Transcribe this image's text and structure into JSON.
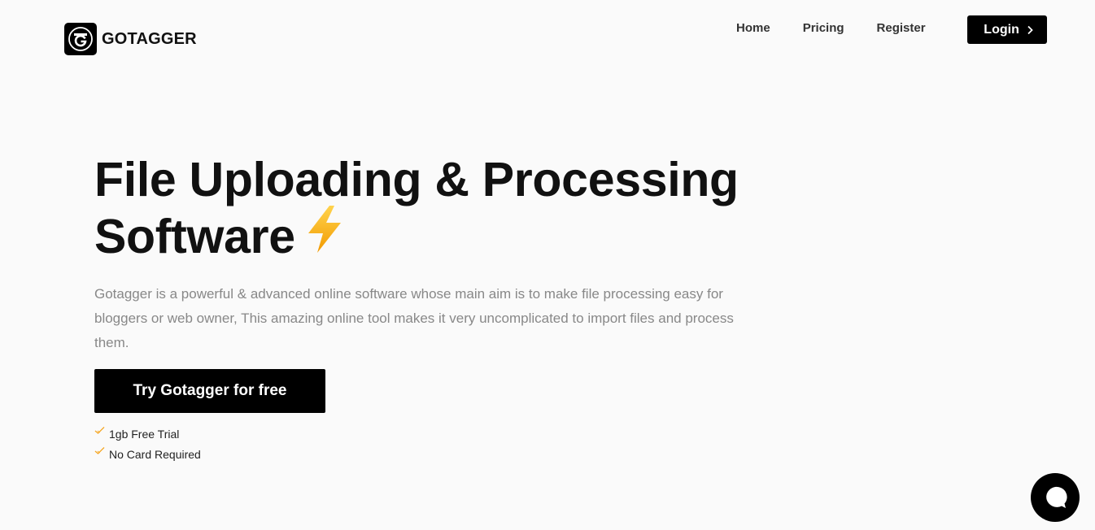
{
  "brand": {
    "name": "GOTAGGER",
    "logo_icon": "gotagger-logo-icon"
  },
  "nav": {
    "items": [
      {
        "label": "Home"
      },
      {
        "label": "Pricing"
      },
      {
        "label": "Register"
      }
    ],
    "login_label": "Login",
    "login_icon": "chevron-right-icon"
  },
  "hero": {
    "title_line1": "File Uploading & Processing",
    "title_line2": "Software",
    "title_icon": "lightning-bolt-icon",
    "description": "Gotagger is a powerful & advanced online software whose main aim is to make file processing easy for bloggers or web owner, This amazing online tool makes it very uncomplicated to import files and process them.",
    "cta_label": "Try Gotagger for free",
    "features": [
      {
        "label": "1gb Free Trial",
        "icon": "check-icon"
      },
      {
        "label": "No Card Required",
        "icon": "check-icon"
      }
    ]
  },
  "chat": {
    "icon": "chat-bubble-icon"
  },
  "colors": {
    "background": "#fafafa",
    "primary": "#000000",
    "accent_check": "#f5a623",
    "bolt": "#f7b500"
  }
}
